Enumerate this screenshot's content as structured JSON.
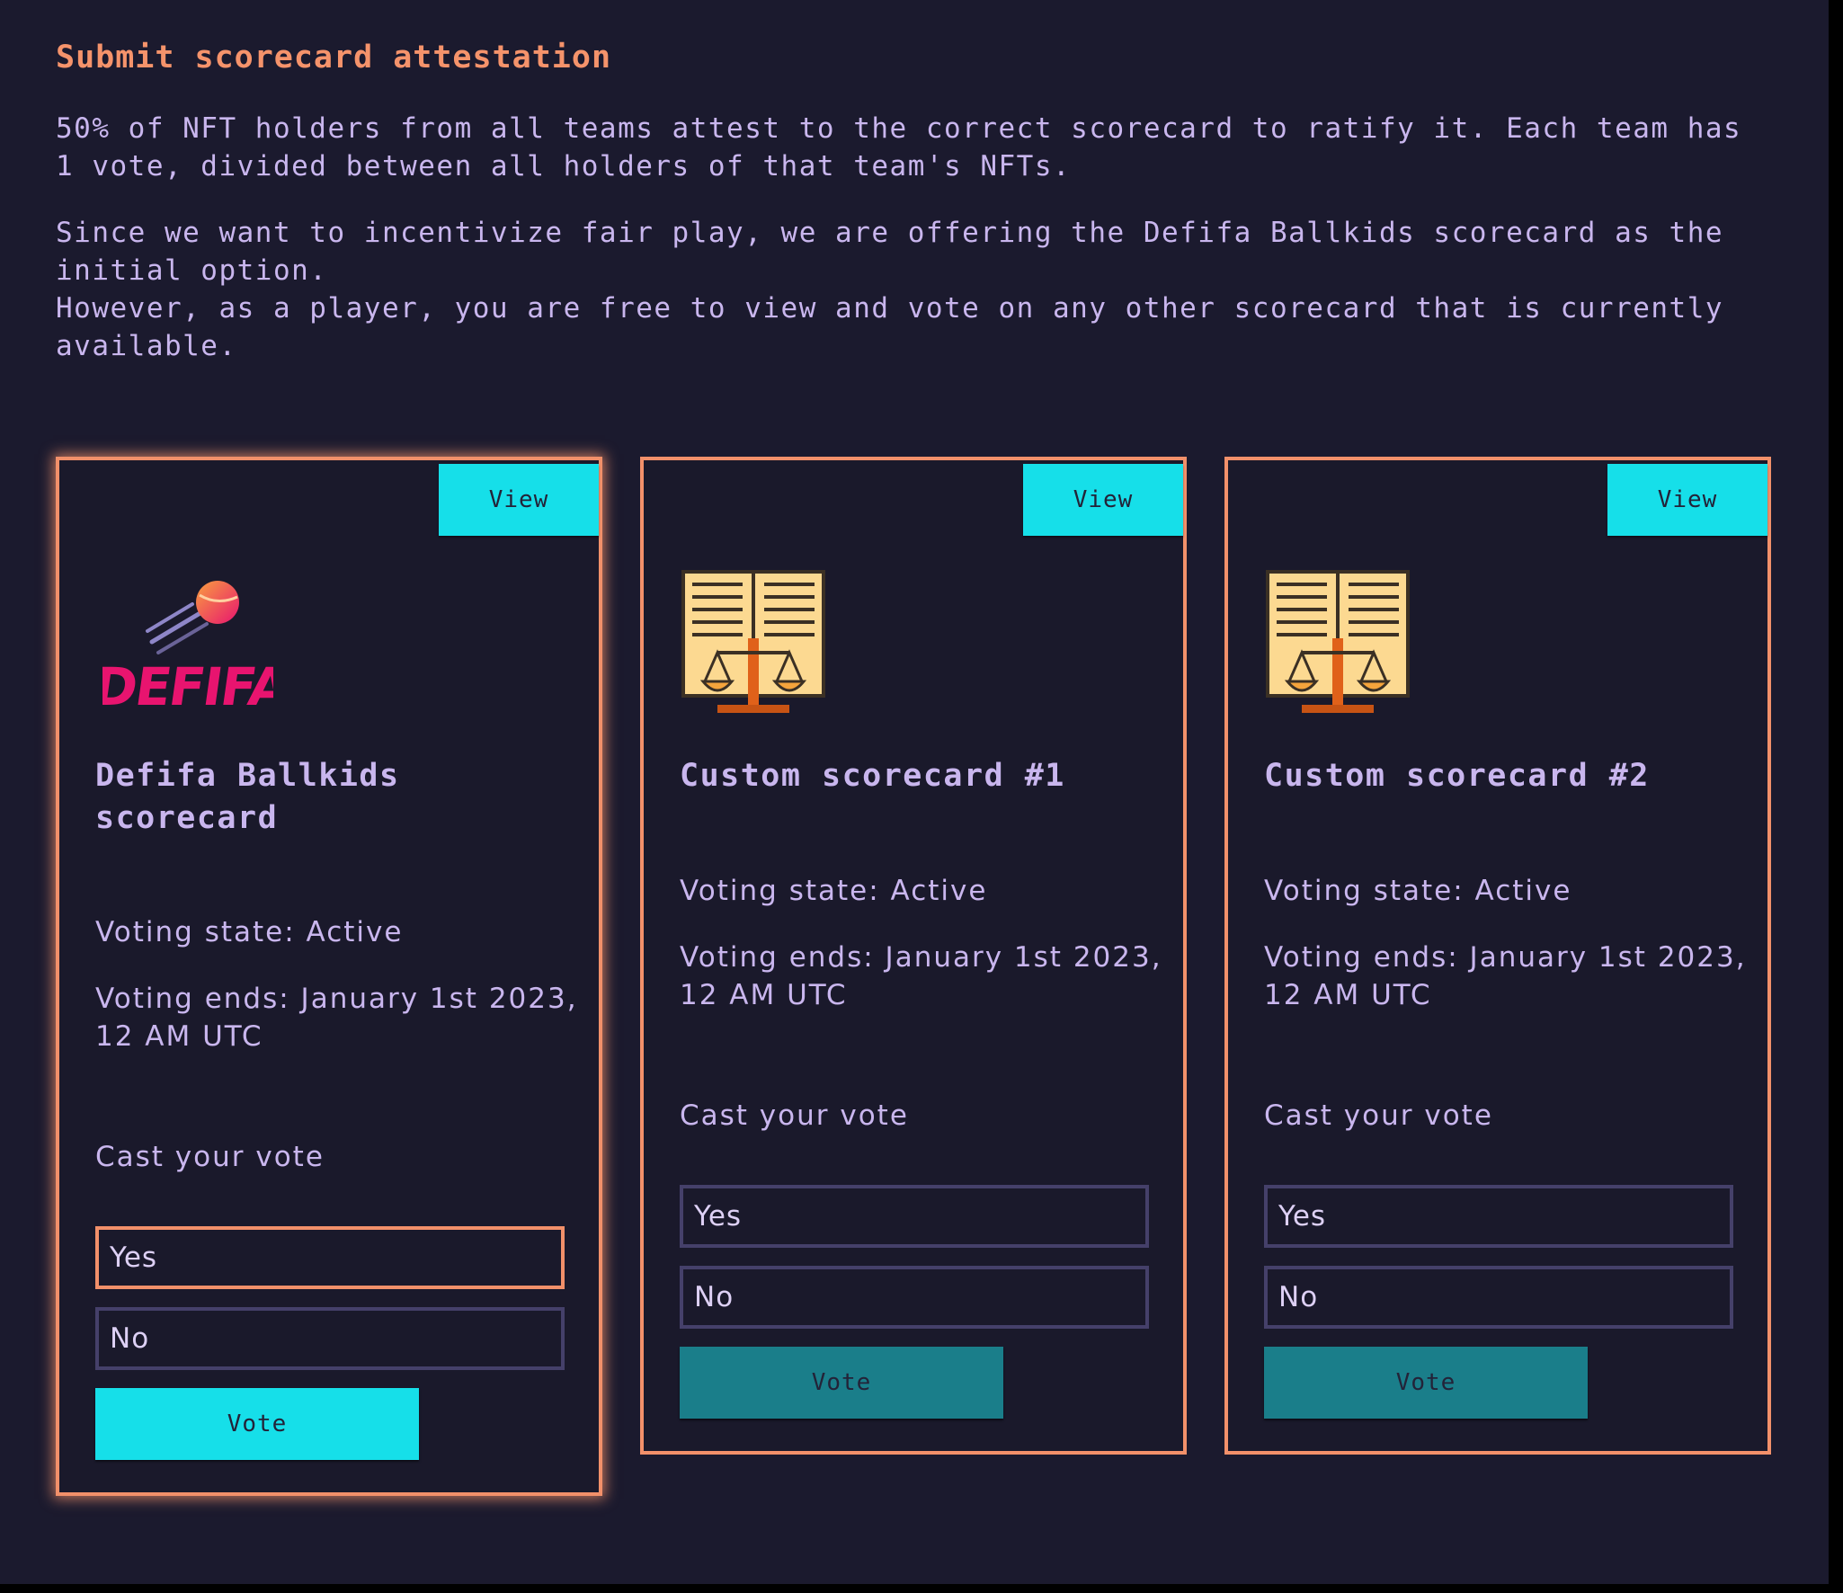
{
  "page": {
    "title": "Submit scorecard attestation",
    "paragraph1": "50% of NFT holders from all teams attest to the correct scorecard to ratify it. Each team has 1 vote, divided between all holders of that team's NFTs.",
    "paragraph2": "Since we want to incentivize fair play, we are offering the Defifa Ballkids scorecard as the initial option.",
    "paragraph3": "However, as a player, you are free to view and vote on any other scorecard that is currently available."
  },
  "colors": {
    "accent": "#f2906a",
    "button": "#16dfe9",
    "button_disabled": "#1a7e8a",
    "background": "#1b1a2e",
    "text": "#c9b6ee",
    "logo_text": "#e8146f"
  },
  "cards": [
    {
      "icon": "defifa-logo-icon",
      "logo_text": "DEFIFA",
      "view_label": "View",
      "title": "Defifa Ballkids scorecard",
      "voting_state": "Voting state: Active",
      "voting_ends": "Voting ends: January 1st 2023, 12 AM UTC",
      "cast_label": "Cast your vote",
      "option_yes": "Yes",
      "option_no": "No",
      "selected_option": "Yes",
      "vote_label": "Vote"
    },
    {
      "icon": "law-book-scale-icon",
      "view_label": "View",
      "title": "Custom scorecard #1",
      "voting_state": "Voting state: Active",
      "voting_ends": "Voting ends: January 1st 2023, 12 AM UTC",
      "cast_label": "Cast your vote",
      "option_yes": "Yes",
      "option_no": "No",
      "vote_label": "Vote"
    },
    {
      "icon": "law-book-scale-icon",
      "view_label": "View",
      "title": "Custom scorecard #2",
      "voting_state": "Voting state: Active",
      "voting_ends": "Voting ends: January 1st 2023, 12 AM UTC",
      "cast_label": "Cast your vote",
      "option_yes": "Yes",
      "option_no": "No",
      "vote_label": "Vote"
    }
  ]
}
